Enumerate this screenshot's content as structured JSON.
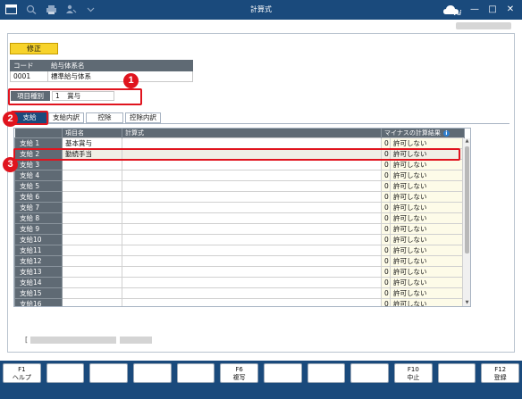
{
  "window": {
    "title": "計算式",
    "minimize_glyph": "—",
    "maximize_glyph": "□",
    "close_glyph": "✕"
  },
  "toolbar": {
    "icons": [
      "window-icon",
      "search-icon",
      "print-icon",
      "user-settings-icon",
      "dropdown-icon"
    ]
  },
  "brand": {
    "logo_text": "Ai"
  },
  "edit_button_label": "修正",
  "code_table": {
    "headers": [
      "コード",
      "給与体系名"
    ],
    "row": [
      "0001",
      "標準給与体系"
    ]
  },
  "item_kind": {
    "label": "項目種別",
    "number": "1",
    "value": "賞与"
  },
  "tabs": [
    "支給",
    "支給内訳",
    "控除",
    "控除内訳"
  ],
  "active_tab_index": 0,
  "grid": {
    "headers": {
      "name": "項目名",
      "formula": "計算式",
      "negative": "マイナスの計算結果"
    },
    "rows": [
      {
        "label": "支給 1",
        "name": "基本賞与",
        "formula": "",
        "num": "0",
        "result": "許可しない"
      },
      {
        "label": "支給 2",
        "name": "勤続手当",
        "formula": "",
        "num": "0",
        "result": "許可しない"
      },
      {
        "label": "支給 3",
        "name": "",
        "formula": "",
        "num": "0",
        "result": "許可しない"
      },
      {
        "label": "支給 4",
        "name": "",
        "formula": "",
        "num": "0",
        "result": "許可しない"
      },
      {
        "label": "支給 5",
        "name": "",
        "formula": "",
        "num": "0",
        "result": "許可しない"
      },
      {
        "label": "支給 6",
        "name": "",
        "formula": "",
        "num": "0",
        "result": "許可しない"
      },
      {
        "label": "支給 7",
        "name": "",
        "formula": "",
        "num": "0",
        "result": "許可しない"
      },
      {
        "label": "支給 8",
        "name": "",
        "formula": "",
        "num": "0",
        "result": "許可しない"
      },
      {
        "label": "支給 9",
        "name": "",
        "formula": "",
        "num": "0",
        "result": "許可しない"
      },
      {
        "label": "支給10",
        "name": "",
        "formula": "",
        "num": "0",
        "result": "許可しない"
      },
      {
        "label": "支給11",
        "name": "",
        "formula": "",
        "num": "0",
        "result": "許可しない"
      },
      {
        "label": "支給12",
        "name": "",
        "formula": "",
        "num": "0",
        "result": "許可しない"
      },
      {
        "label": "支給13",
        "name": "",
        "formula": "",
        "num": "0",
        "result": "許可しない"
      },
      {
        "label": "支給14",
        "name": "",
        "formula": "",
        "num": "0",
        "result": "許可しない"
      },
      {
        "label": "支給15",
        "name": "",
        "formula": "",
        "num": "0",
        "result": "許可しない"
      },
      {
        "label": "支給16",
        "name": "",
        "formula": "",
        "num": "0",
        "result": "許可しない"
      }
    ],
    "selected_row_index": 1
  },
  "callouts": [
    "1",
    "2",
    "3"
  ],
  "status": {
    "open_bracket": "[",
    "close_bracket": "]"
  },
  "fkeys": [
    {
      "key": "F1",
      "label": "ヘルプ"
    },
    {
      "key": "",
      "label": ""
    },
    {
      "key": "",
      "label": ""
    },
    {
      "key": "",
      "label": ""
    },
    {
      "key": "",
      "label": ""
    },
    {
      "key": "F6",
      "label": "複写"
    },
    {
      "key": "",
      "label": ""
    },
    {
      "key": "",
      "label": ""
    },
    {
      "key": "",
      "label": ""
    },
    {
      "key": "F10",
      "label": "中止"
    },
    {
      "key": "",
      "label": ""
    },
    {
      "key": "F12",
      "label": "登録"
    }
  ],
  "colors": {
    "titlebar": "#1a4a7c",
    "header_gray": "#5f6a74",
    "edit_yellow": "#f7d32b",
    "callout_red": "#e0141e",
    "result_cell": "#fdfbe8"
  }
}
